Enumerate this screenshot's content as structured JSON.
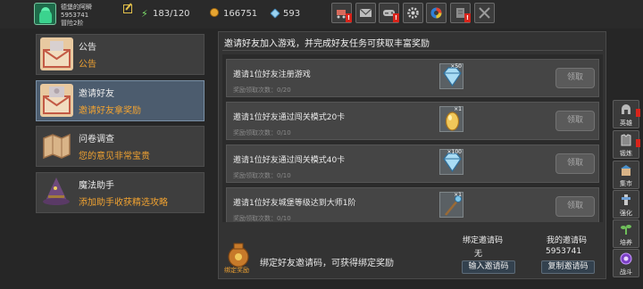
{
  "player": {
    "name": "德堡的阿瞬",
    "id": "5953741",
    "level": "冒险2阶"
  },
  "stats": {
    "energy": "183/120",
    "gold": "166751",
    "gems": "593"
  },
  "toolbar": [
    "shop-cart-icon",
    "mail-icon",
    "controller-icon",
    "settings-gear-icon",
    "game-center-icon",
    "event-scroll-icon",
    "battle-swords-icon"
  ],
  "sidebar": {
    "items": [
      {
        "title": "公告",
        "subtitle": "公告"
      },
      {
        "title": "邀请好友",
        "subtitle": "邀请好友拿奖励"
      },
      {
        "title": "问卷调查",
        "subtitle": "您的意见非常宝贵"
      },
      {
        "title": "魔法助手",
        "subtitle": "添加助手收获精选攻略"
      }
    ]
  },
  "panel": {
    "title": "邀请好友加入游戏，并完成好友任务可获取丰富奖励",
    "tasks": [
      {
        "name": "邀请1位好友注册游戏",
        "progress": "奖励领取次数：0/20",
        "reward_count": "×50",
        "reward_icon": "diamond-icon",
        "claim": "领取"
      },
      {
        "name": "邀请1位好友通过闯关模式20卡",
        "progress": "奖励领取次数：0/10",
        "reward_count": "×1",
        "reward_icon": "golden-egg-icon",
        "claim": "领取"
      },
      {
        "name": "邀请1位好友通过闯关模式40卡",
        "progress": "奖励领取次数：0/10",
        "reward_count": "×100",
        "reward_icon": "diamond-icon",
        "claim": "领取"
      },
      {
        "name": "邀请1位好友城堡等级达到大师1阶",
        "progress": "奖励领取次数：0/10",
        "reward_count": "×1",
        "reward_icon": "staff-icon",
        "claim": "领取"
      }
    ],
    "bind": {
      "reward_label": "绑定奖励",
      "desc": "绑定好友邀请码，可获得绑定奖励",
      "bound_code_title": "绑定邀请码",
      "bound_code_value": "无",
      "input_button": "输入邀请码",
      "my_code_title": "我的邀请码",
      "my_code_value": "5953741",
      "copy_button": "复制邀请码"
    }
  },
  "right_nav": [
    {
      "label": "英雄",
      "icon": "hero-helmet-icon"
    },
    {
      "label": "锻炼",
      "icon": "armor-icon"
    },
    {
      "label": "集市",
      "icon": "market-icon"
    },
    {
      "label": "强化",
      "icon": "upgrade-icon"
    },
    {
      "label": "培养",
      "icon": "cultivate-icon"
    },
    {
      "label": "战斗",
      "icon": "battle-orb-icon"
    }
  ],
  "colors": {
    "accent_orange": "#f0a231",
    "alert_red": "#d8241b",
    "selected_item": "#4c5c6e"
  }
}
